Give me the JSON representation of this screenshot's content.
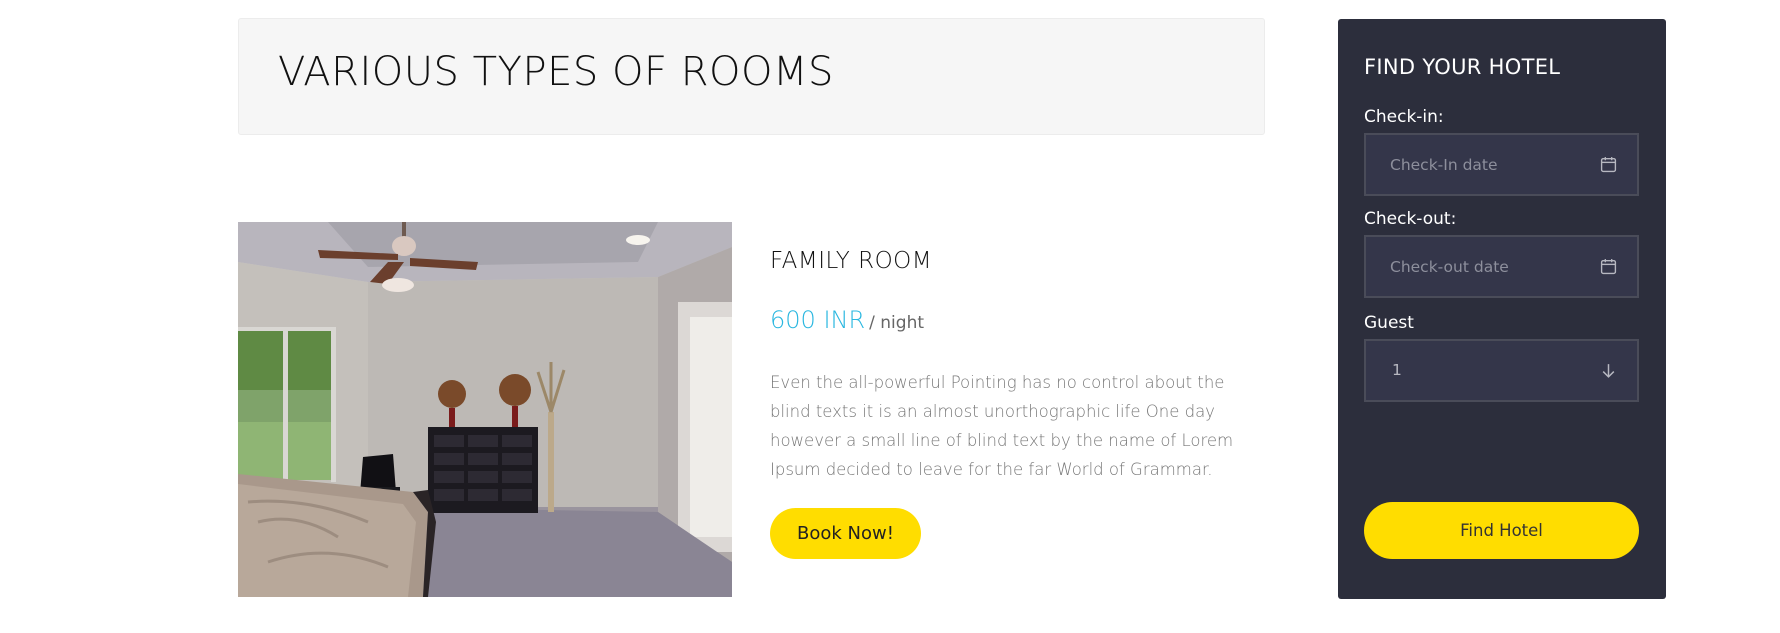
{
  "header": {
    "title": "VARIOUS TYPES OF ROOMS"
  },
  "room": {
    "image_alt": "bedroom-photo",
    "name": "FAMILY ROOM",
    "price": "600 INR",
    "price_unit": "/ night",
    "description": "Even the all-powerful Pointing has no control about the blind texts it is an almost unorthographic life One day however a small line of blind text by the name of Lorem Ipsum decided to leave for the far World of Grammar.",
    "book_label": "Book Now!"
  },
  "search": {
    "title": "FIND YOUR HOTEL",
    "checkin_label": "Check-in:",
    "checkin_placeholder": "Check-In date",
    "checkout_label": "Check-out:",
    "checkout_placeholder": "Check-out date",
    "guest_label": "Guest",
    "guest_value": "1",
    "submit_label": "Find Hotel"
  },
  "colors": {
    "accent_yellow": "#ffdd00",
    "price_blue": "#2ab7e0",
    "sidebar_bg": "#2c2e3c"
  },
  "icons": {
    "checkin": "calendar-icon",
    "checkout": "calendar-icon",
    "guest": "arrow-down-icon"
  }
}
